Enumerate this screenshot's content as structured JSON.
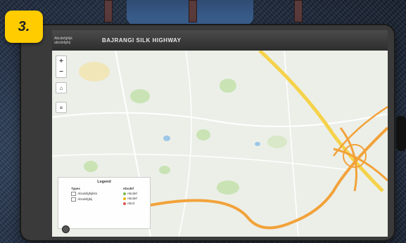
{
  "badge": {
    "label": "3."
  },
  "app": {
    "logo_line1": "Abcdefghijk",
    "logo_line2": "abcdefghij",
    "title": "BAJRANGI SILK HIGHWAY"
  },
  "map_controls": {
    "zoom_in": "+",
    "zoom_out": "−",
    "home_icon": "home-icon",
    "layers_icon": "layers-icon"
  },
  "legend": {
    "title": "Legend",
    "col1_header": "Types",
    "col1_items": [
      "Abcdefghijklm",
      "Abcdefghij"
    ],
    "col2_header": "Abcdef",
    "col2_items": [
      "Abcdef",
      "Abcdef",
      "Abcd"
    ],
    "colors": [
      "#7ab648",
      "#e8b400",
      "#d9534f"
    ]
  },
  "colors": {
    "badge": "#ffcc00",
    "road_major": "#f2a23a",
    "road_highway": "#f5d24a",
    "park": "#c9e3b5"
  }
}
